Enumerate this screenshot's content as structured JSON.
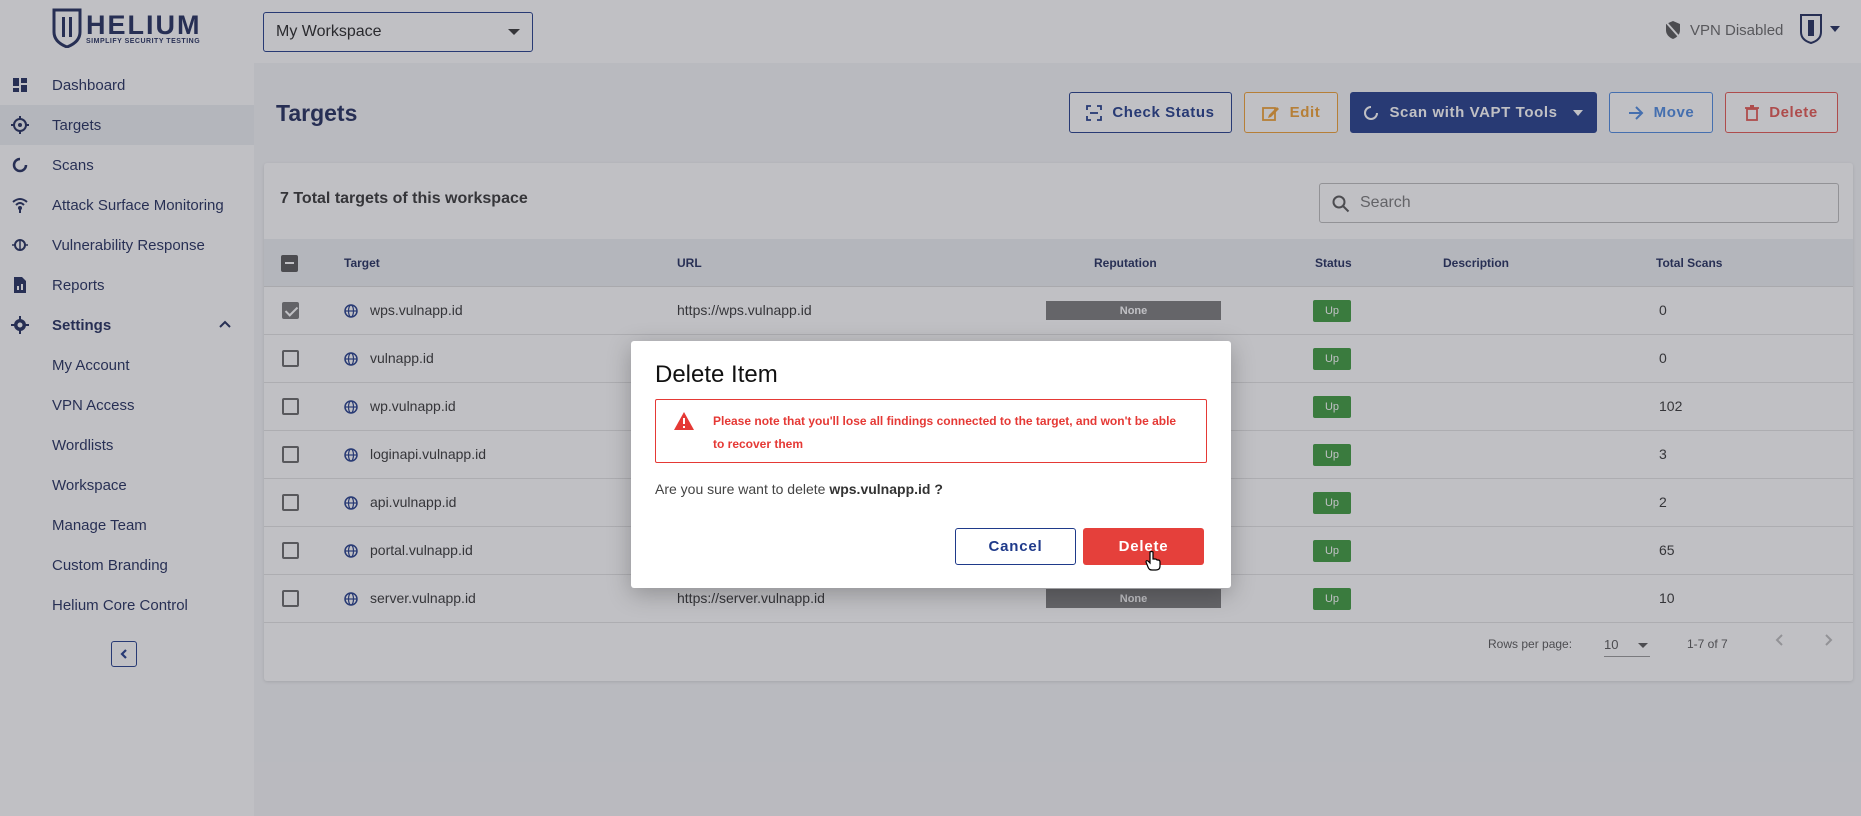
{
  "brand": {
    "name": "HELIUM",
    "tagline": "SIMPLIFY SECURITY TESTING"
  },
  "workspace_select": {
    "value": "My Workspace"
  },
  "vpn": {
    "label": "VPN Disabled"
  },
  "sidebar": {
    "items": [
      {
        "label": "Dashboard",
        "icon": "dashboard-icon"
      },
      {
        "label": "Targets",
        "icon": "target-icon"
      },
      {
        "label": "Scans",
        "icon": "scan-icon"
      },
      {
        "label": "Attack Surface Monitoring",
        "icon": "radar-icon"
      },
      {
        "label": "Vulnerability Response",
        "icon": "bug-icon"
      },
      {
        "label": "Reports",
        "icon": "report-icon"
      },
      {
        "label": "Settings",
        "icon": "gear-icon"
      }
    ],
    "settings_items": [
      {
        "label": "My Account"
      },
      {
        "label": "VPN Access"
      },
      {
        "label": "Wordlists"
      },
      {
        "label": "Workspace"
      },
      {
        "label": "Manage Team"
      },
      {
        "label": "Custom Branding"
      },
      {
        "label": "Helium Core Control"
      }
    ]
  },
  "page": {
    "title": "Targets",
    "actions": {
      "check_status": "Check Status",
      "edit": "Edit",
      "scan": "Scan with VAPT Tools",
      "move": "Move",
      "delete": "Delete"
    }
  },
  "card": {
    "total_label": "7 Total targets of this workspace",
    "search_placeholder": "Search"
  },
  "table": {
    "columns": {
      "target": "Target",
      "url": "URL",
      "reputation": "Reputation",
      "status": "Status",
      "description": "Description",
      "total_scans": "Total Scans"
    },
    "rows": [
      {
        "target": "wps.vulnapp.id",
        "url": "https://wps.vulnapp.id",
        "reputation": "None",
        "status": "Up",
        "scans": "0",
        "checked": true
      },
      {
        "target": "vulnapp.id",
        "url": "",
        "reputation": "",
        "status": "Up",
        "scans": "0",
        "checked": false
      },
      {
        "target": "wp.vulnapp.id",
        "url": "",
        "reputation": "",
        "status": "Up",
        "scans": "102",
        "checked": false
      },
      {
        "target": "loginapi.vulnapp.id",
        "url": "",
        "reputation": "",
        "status": "Up",
        "scans": "3",
        "checked": false
      },
      {
        "target": "api.vulnapp.id",
        "url": "",
        "reputation": "",
        "status": "Up",
        "scans": "2",
        "checked": false
      },
      {
        "target": "portal.vulnapp.id",
        "url": "",
        "reputation": "",
        "status": "Up",
        "scans": "65",
        "checked": false
      },
      {
        "target": "server.vulnapp.id",
        "url": "https://server.vulnapp.id",
        "reputation": "None",
        "status": "Up",
        "scans": "10",
        "checked": false
      }
    ]
  },
  "pagination": {
    "rows_per_page_label": "Rows per page:",
    "rows_per_page_value": "10",
    "range": "1-7 of 7"
  },
  "modal": {
    "title": "Delete Item",
    "warning": "Please note that you'll lose all findings connected to the target, and won't be able to recover them",
    "confirm_prefix": "Are you sure want to delete",
    "confirm_target": "wps.vulnapp.id ?",
    "cancel_label": "Cancel",
    "delete_label": "Delete"
  },
  "colors": {
    "brand_navy": "#1e2a5a",
    "primary": "#1f3a8a",
    "danger": "#e5403b",
    "warning": "#f0a030",
    "info": "#4a88e0",
    "status_up": "#3a9a3a"
  }
}
